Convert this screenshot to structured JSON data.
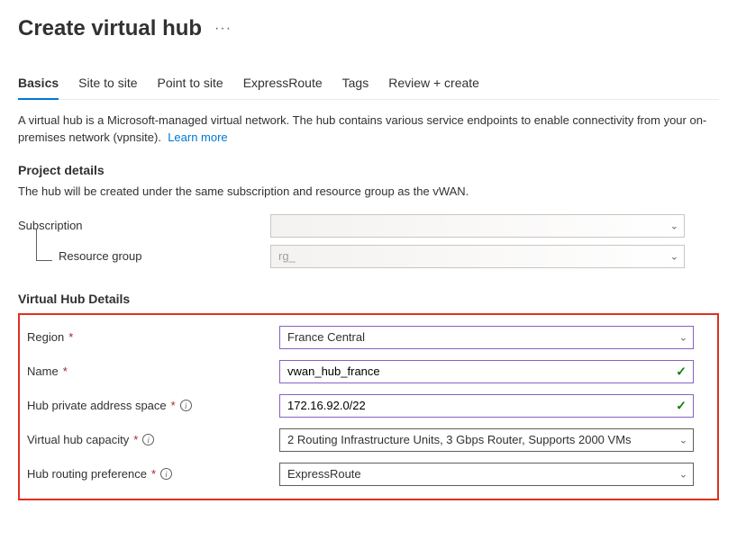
{
  "title": "Create virtual hub",
  "tabs": [
    {
      "label": "Basics",
      "active": true
    },
    {
      "label": "Site to site",
      "active": false
    },
    {
      "label": "Point to site",
      "active": false
    },
    {
      "label": "ExpressRoute",
      "active": false
    },
    {
      "label": "Tags",
      "active": false
    },
    {
      "label": "Review + create",
      "active": false
    }
  ],
  "desc": "A virtual hub is a Microsoft-managed virtual network. The hub contains various service endpoints to enable connectivity from your on-premises network (vpnsite).",
  "learn_more": "Learn more",
  "project": {
    "heading": "Project details",
    "hint": "The hub will be created under the same subscription and resource group as the vWAN.",
    "subscription_label": "Subscription",
    "subscription_value": "",
    "rg_label": "Resource group",
    "rg_value": "rg_"
  },
  "details": {
    "heading": "Virtual Hub Details",
    "region_label": "Region",
    "region_value": "France Central",
    "name_label": "Name",
    "name_value": "vwan_hub_france",
    "addr_label": "Hub private address space",
    "addr_value": "172.16.92.0/22",
    "capacity_label": "Virtual hub capacity",
    "capacity_value": "2 Routing Infrastructure Units, 3 Gbps Router, Supports 2000 VMs",
    "routepref_label": "Hub routing preference",
    "routepref_value": "ExpressRoute"
  }
}
